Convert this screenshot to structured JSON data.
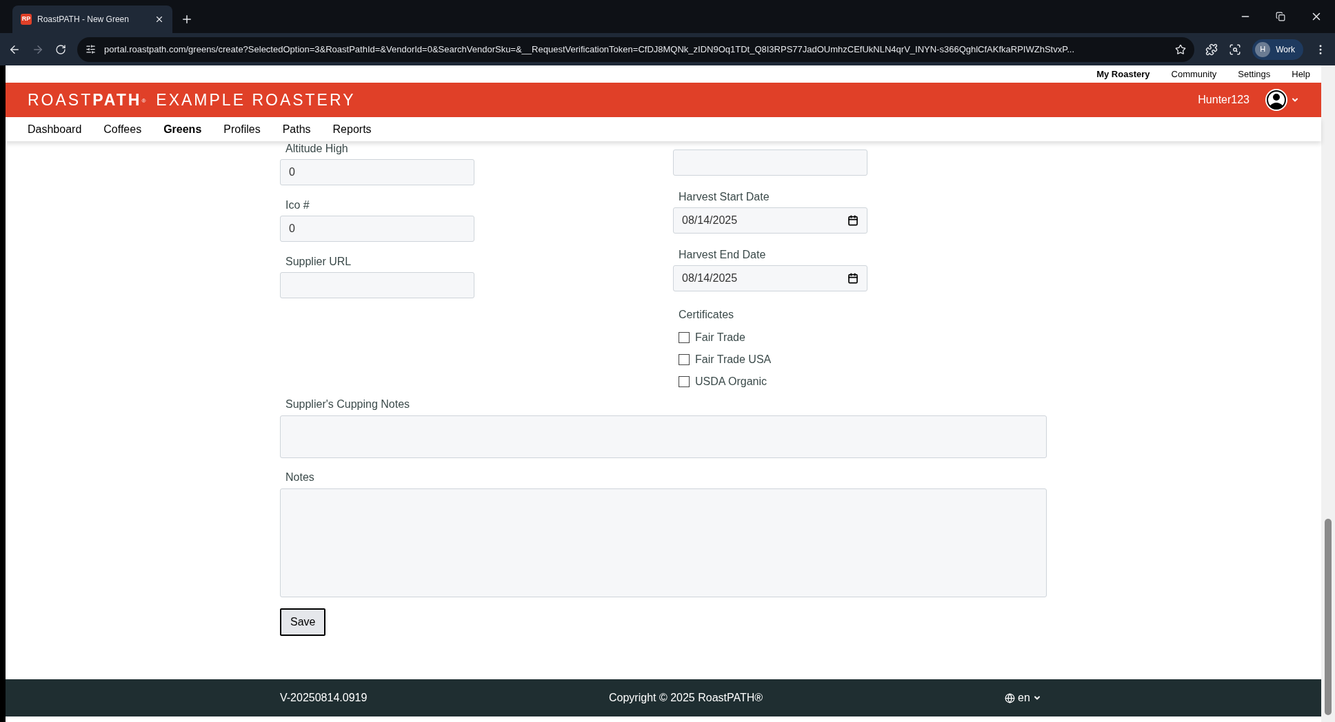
{
  "browser": {
    "tab_icon": "RP",
    "tab_title": "RoastPATH - New Green",
    "url": "portal.roastpath.com/greens/create?SelectedOption=3&RoastPathId=&VendorId=0&SearchVendorSku=&__RequestVerificationToken=CfDJ8MQNk_zIDN9Oq1TDt_Q8I3RPS77JadOUmhzCEfUkNLN4qrV_INYN-s366QghlCfAKfkaRPIWZhStvxP...",
    "profile_initial": "H",
    "profile_name": "Work"
  },
  "top_links": [
    {
      "label": "My Roastery",
      "selected": true
    },
    {
      "label": "Community",
      "selected": false
    },
    {
      "label": "Settings",
      "selected": false
    },
    {
      "label": "Help",
      "selected": false
    }
  ],
  "header": {
    "brand_light": "ROAST",
    "brand_bold": "PATH",
    "brand_mark": "®",
    "roastery": "EXAMPLE ROASTERY",
    "username": "Hunter123"
  },
  "nav": [
    {
      "label": "Dashboard",
      "selected": false
    },
    {
      "label": "Coffees",
      "selected": false
    },
    {
      "label": "Greens",
      "selected": true
    },
    {
      "label": "Profiles",
      "selected": false
    },
    {
      "label": "Paths",
      "selected": false
    },
    {
      "label": "Reports",
      "selected": false
    }
  ],
  "left_fields": [
    {
      "label": "Altitude High",
      "kind": "text",
      "value": "0"
    },
    {
      "label": "Ico #",
      "kind": "text",
      "value": "0"
    },
    {
      "label": "Supplier URL",
      "kind": "text"
    }
  ],
  "right_fields": [
    {
      "kind": "text"
    },
    {
      "label": "Harvest Start Date",
      "kind": "date",
      "value": "08/14/2025"
    },
    {
      "label": "Harvest End Date",
      "kind": "date",
      "value": "08/14/2025"
    }
  ],
  "certificates": {
    "label": "Certificates",
    "options": [
      {
        "label": "Fair Trade",
        "checked": false
      },
      {
        "label": "Fair Trade USA",
        "checked": false
      },
      {
        "label": "USDA Organic",
        "checked": false
      }
    ]
  },
  "text_areas": [
    {
      "label": "Supplier's Cupping Notes",
      "kind": "short"
    },
    {
      "label": "Notes",
      "kind": "tall"
    }
  ],
  "save_button": "Save",
  "footer": {
    "version": "V-20250814.0919",
    "copyright": "Copyright © 2025 RoastPATH®",
    "language": "en"
  }
}
